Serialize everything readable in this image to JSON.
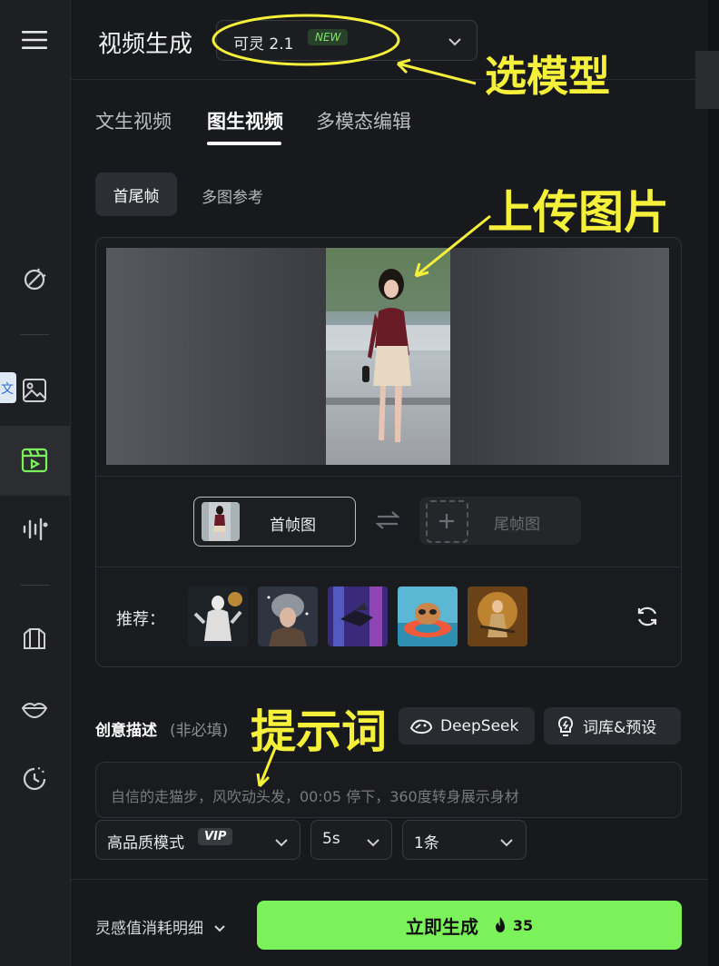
{
  "header": {
    "title": "视频生成"
  },
  "model_select": {
    "value": "可灵 2.1",
    "badge": "NEW"
  },
  "tabs": [
    {
      "label": "文生视频"
    },
    {
      "label": "图生视频"
    },
    {
      "label": "多模态编辑"
    }
  ],
  "active_tab": "图生视频",
  "subtabs": [
    {
      "label": "首尾帧"
    },
    {
      "label": "多图参考"
    }
  ],
  "frames": {
    "first_label": "首帧图",
    "last_label": "尾帧图"
  },
  "recommend": {
    "label": "推荐："
  },
  "prompt": {
    "label": "创意描述",
    "optional": "(非必填)",
    "deepseek_label": "DeepSeek",
    "library_label": "词库&预设",
    "text": "自信的走猫步，风吹动头发，00:05 停下，360度转身展示身材"
  },
  "settings": {
    "mode": "高品质模式",
    "mode_badge": "VIP",
    "duration": "5s",
    "count": "1条"
  },
  "footer": {
    "cost_link": "灵感值消耗明细",
    "generate_label": "立即生成",
    "generate_cost": "35"
  },
  "annotations": {
    "model": "选模型",
    "upload": "上传图片",
    "prompt": "提示词"
  },
  "colors": {
    "accent": "#7cf25a",
    "annotation": "#f5f03a",
    "background": "#18191c"
  }
}
